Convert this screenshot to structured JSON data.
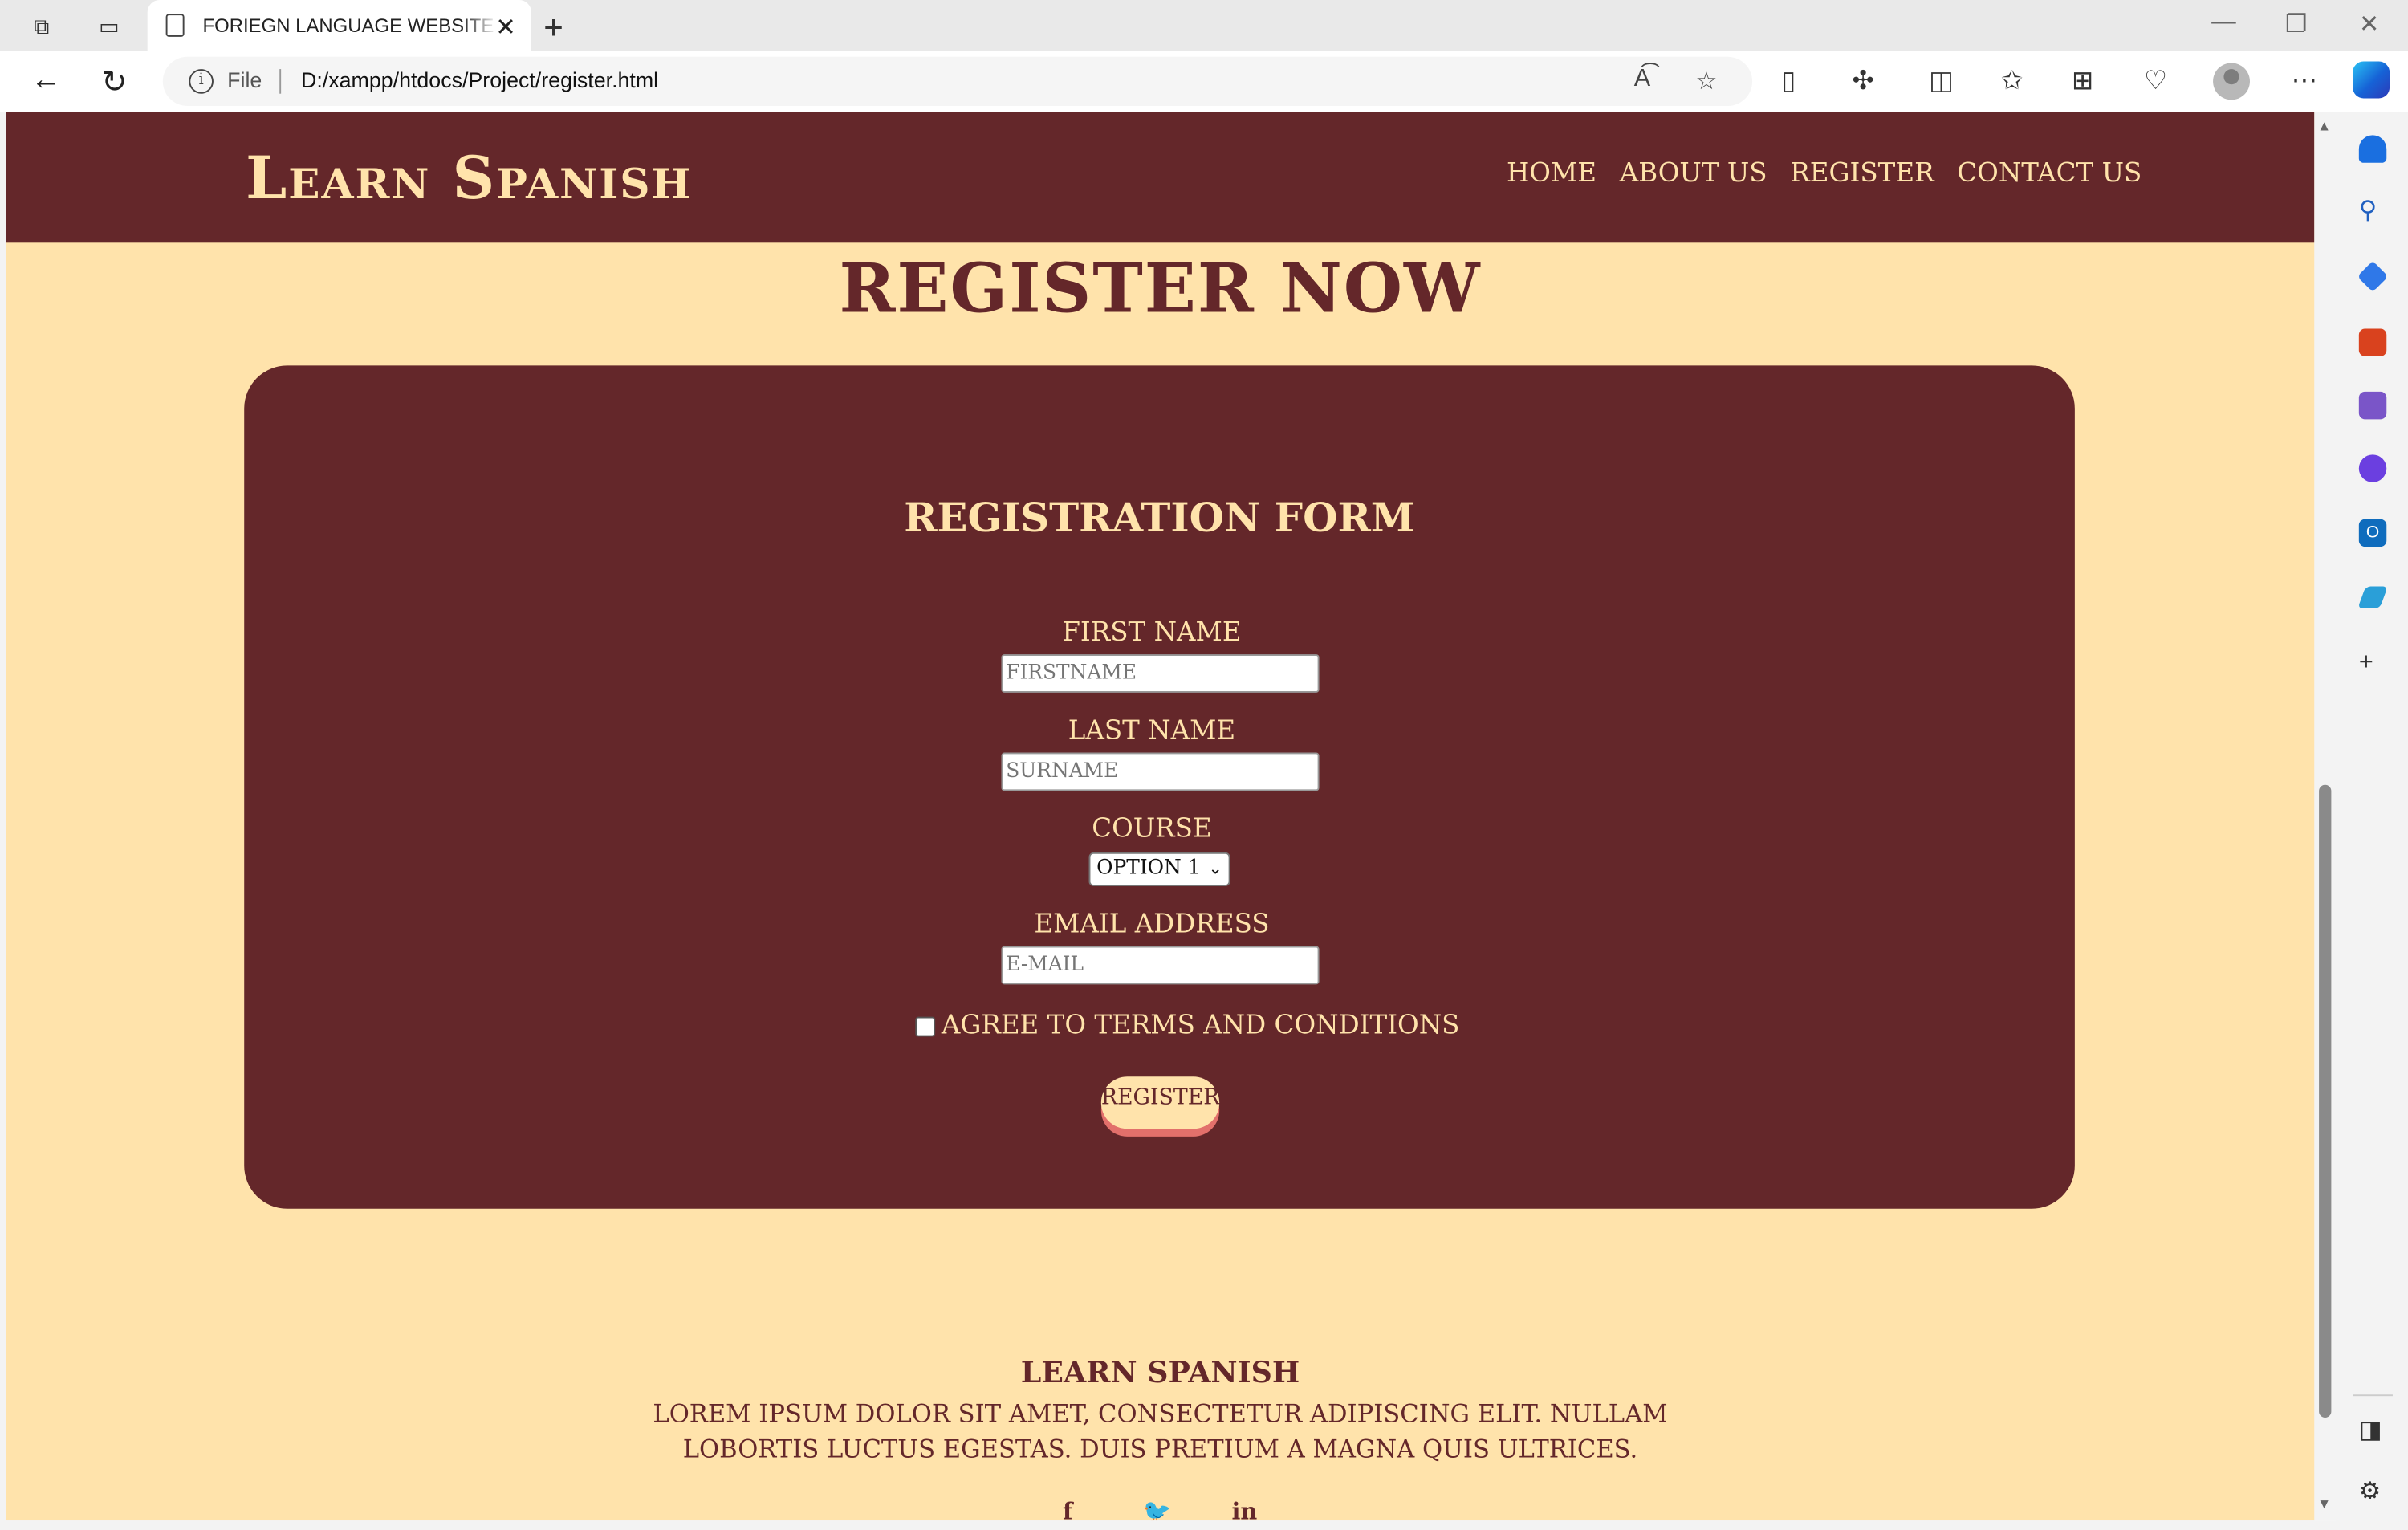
{
  "browser": {
    "tab_title": "FORIEGN LANGUAGE WEBSITE REGISTER",
    "url_scheme": "File",
    "url": "D:/xampp/htdocs/Project/register.html"
  },
  "header": {
    "logo": "Learn Spanish",
    "nav": [
      "Home",
      "About Us",
      "Register",
      "Contact Us"
    ]
  },
  "page": {
    "title": "Register Now"
  },
  "form": {
    "title": "Registration Form",
    "first_name_label": "First Name",
    "first_name_placeholder": "FIRSTNAME",
    "last_name_label": "Last Name",
    "last_name_placeholder": "SURNAME",
    "course_label": "Course",
    "course_selected": "OPTION 1",
    "email_label": "Email Address",
    "email_placeholder": "E-MAIL",
    "agree_label": "Agree to Terms and Conditions",
    "agree_checked": false,
    "submit_label": "Register"
  },
  "footer": {
    "title": "Learn Spanish",
    "text": "Lorem ipsum dolor sit amet, consectetur adipiscing elit. Nullam lobortis luctus egestas. Duis pretium a magna quis ultrices.",
    "social_icons": [
      "facebook-icon",
      "twitter-icon",
      "linkedin-icon"
    ]
  },
  "colors": {
    "maroon": "#64272a",
    "cream": "#ffe3ab",
    "button_shadow": "#e2706b"
  }
}
